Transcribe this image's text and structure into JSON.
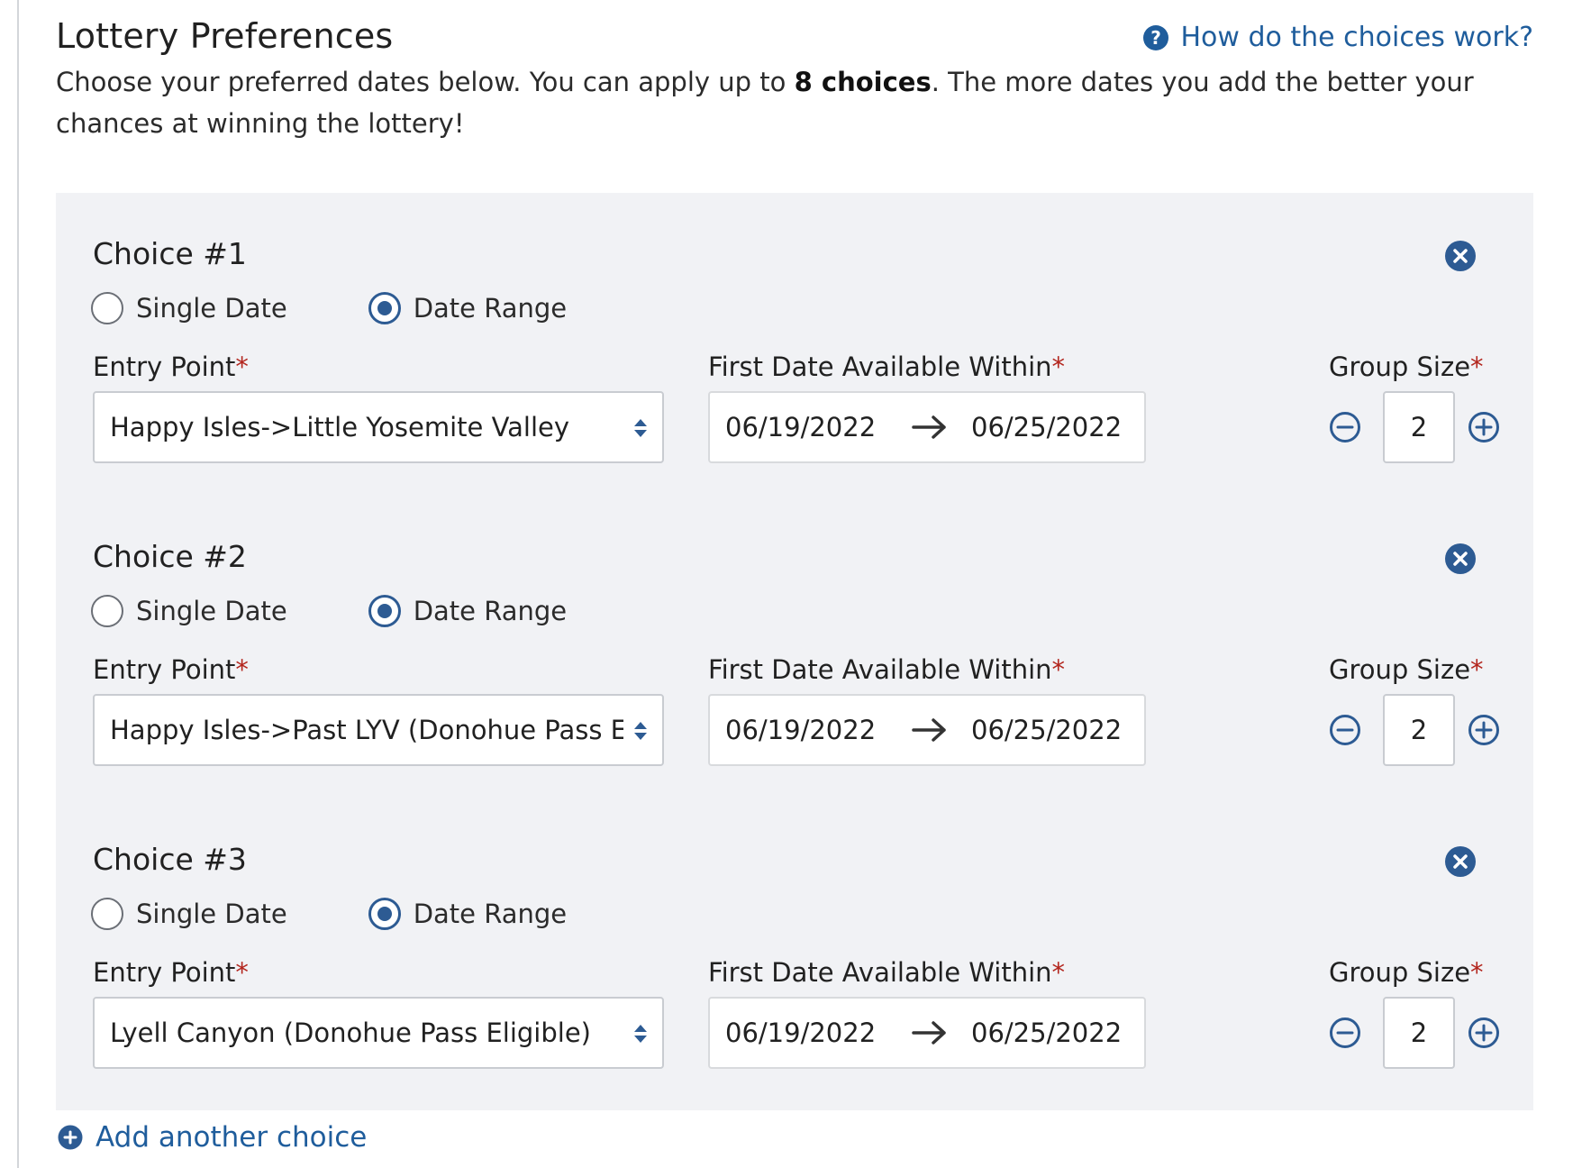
{
  "header": {
    "title": "Lottery Preferences",
    "help_link": "How do the choices work?",
    "intro_before": "Choose your preferred dates below. You can apply up to ",
    "intro_bold": "8 choices",
    "intro_after": ". The more dates you add the better your chances at winning the lottery!"
  },
  "labels": {
    "single_date": "Single Date",
    "date_range": "Date Range",
    "entry_point": "Entry Point",
    "first_date": "First Date Available Within",
    "group_size": "Group Size",
    "required_mark": "*"
  },
  "choices": [
    {
      "title": "Choice #1",
      "mode": "Date Range",
      "entry_point": "Happy Isles->Little Yosemite Valley",
      "start_date": "06/19/2022",
      "end_date": "06/25/2022",
      "group_size": "2"
    },
    {
      "title": "Choice #2",
      "mode": "Date Range",
      "entry_point": "Happy Isles->Past LYV (Donohue Pass Eligi",
      "start_date": "06/19/2022",
      "end_date": "06/25/2022",
      "group_size": "2"
    },
    {
      "title": "Choice #3",
      "mode": "Date Range",
      "entry_point": "Lyell Canyon (Donohue Pass Eligible)",
      "start_date": "06/19/2022",
      "end_date": "06/25/2022",
      "group_size": "2"
    }
  ],
  "footer": {
    "add_choice": "Add another choice"
  },
  "icons": {
    "help": "question-circle-icon",
    "remove": "close-circle-icon",
    "caret": "sort-caret-icon",
    "arrow": "arrow-right-icon",
    "minus": "minus-circle-icon",
    "plus": "plus-circle-icon",
    "add": "plus-circle-filled-icon"
  },
  "colors": {
    "accent": "#1f5d9c",
    "radio": "#2d5b93",
    "required": "#b3261e",
    "panel": "#f1f2f5"
  }
}
